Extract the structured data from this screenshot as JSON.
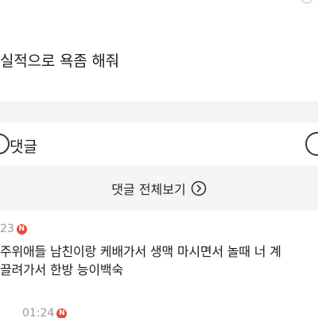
{
  "post": {
    "top_meta": "",
    "body": "실적으로 욕좀 해줘"
  },
  "comments_section": {
    "title": "댓글",
    "view_all_label": "댓글 전체보기",
    "icons": {
      "header_left": "circle-icon",
      "header_right": "circle-icon",
      "view_all": "chevron-right-circle-icon",
      "new_badge": "new-badge-icon"
    }
  },
  "comments": [
    {
      "time": "23",
      "badge": "N",
      "text_line1": "주위애들 남친이랑 케배가서 생맥 마시면서 놀때 너 계",
      "text_line2": "끌려가서 한방 능이백숙"
    },
    {
      "time": "01:24",
      "badge": "N"
    }
  ],
  "colors": {
    "badge_red": "#e84b3c",
    "section_gray": "#f5f5f7",
    "meta_gray": "#9a9a9a"
  }
}
